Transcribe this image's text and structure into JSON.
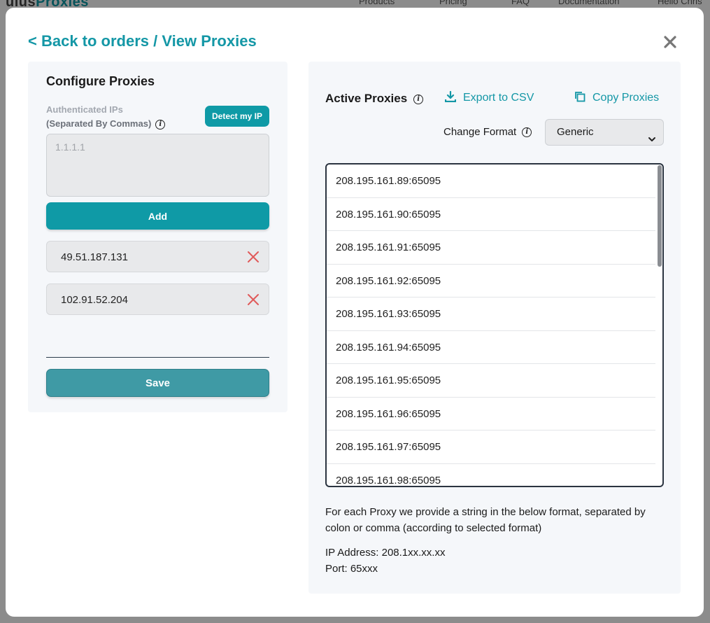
{
  "background": {
    "logo_prefix": "uius",
    "logo_accent": "Proxies",
    "nav": [
      "Products",
      "Pricing",
      "FAQ",
      "Documentation",
      "Hello Chris"
    ]
  },
  "header": {
    "back_link": "< Back to orders / View Proxies",
    "close_icon": "close-icon"
  },
  "configure": {
    "title": "Configure Proxies",
    "label_line1": "Authenticated IPs",
    "label_line2": "(Separated By Commas)",
    "detect_button": "Detect my IP",
    "textarea_placeholder": "1.1.1.1",
    "add_button": "Add",
    "ips": [
      "49.51.187.131",
      "102.91.52.204"
    ],
    "save_button": "Save"
  },
  "active": {
    "title": "Active Proxies",
    "export_label": "Export to CSV",
    "copy_label": "Copy Proxies",
    "format_label": "Change Format",
    "format_selected": "Generic",
    "proxies": [
      "208.195.161.89:65095",
      "208.195.161.90:65095",
      "208.195.161.91:65095",
      "208.195.161.92:65095",
      "208.195.161.93:65095",
      "208.195.161.94:65095",
      "208.195.161.95:65095",
      "208.195.161.96:65095",
      "208.195.161.97:65095",
      "208.195.161.98:65095"
    ],
    "description": "For each Proxy we provide a string in the below format, separated by colon or comma (according to selected format)",
    "ip_format": "IP Address: 208.1xx.xx.xx",
    "port_format": "Port: 65xxx"
  },
  "colors": {
    "accent": "#1497a6",
    "button": "#0f9aa6",
    "save": "#3f9aa5",
    "remove": "#e05a5a"
  }
}
